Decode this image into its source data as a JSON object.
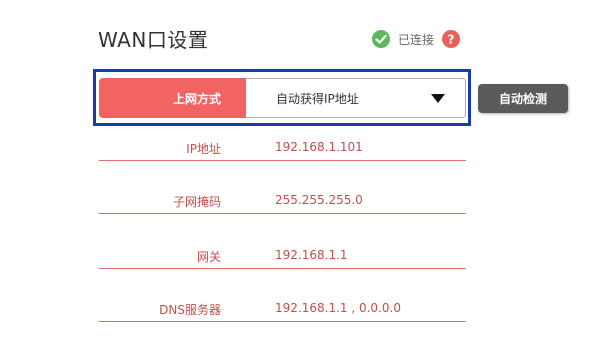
{
  "header": {
    "title": "WAN口设置",
    "status_text": "已连接",
    "status_color": "#5cb85c",
    "help_color": "#e8625c"
  },
  "connection": {
    "mode_label": "上网方式",
    "mode_value": "自动获得IP地址",
    "detect_button": "自动检测"
  },
  "info": {
    "rows": [
      {
        "label": "IP地址",
        "value": "192.168.1.101"
      },
      {
        "label": "子网掩码",
        "value": "255.255.255.0"
      },
      {
        "label": "网关",
        "value": "192.168.1.1"
      },
      {
        "label": "DNS服务器",
        "value": "192.168.1.1 , 0.0.0.0"
      }
    ]
  },
  "colors": {
    "accent": "#f26464",
    "highlight_border": "#1a3ab5",
    "text_red": "#c0504d",
    "button_gray": "#5a5a5a"
  }
}
